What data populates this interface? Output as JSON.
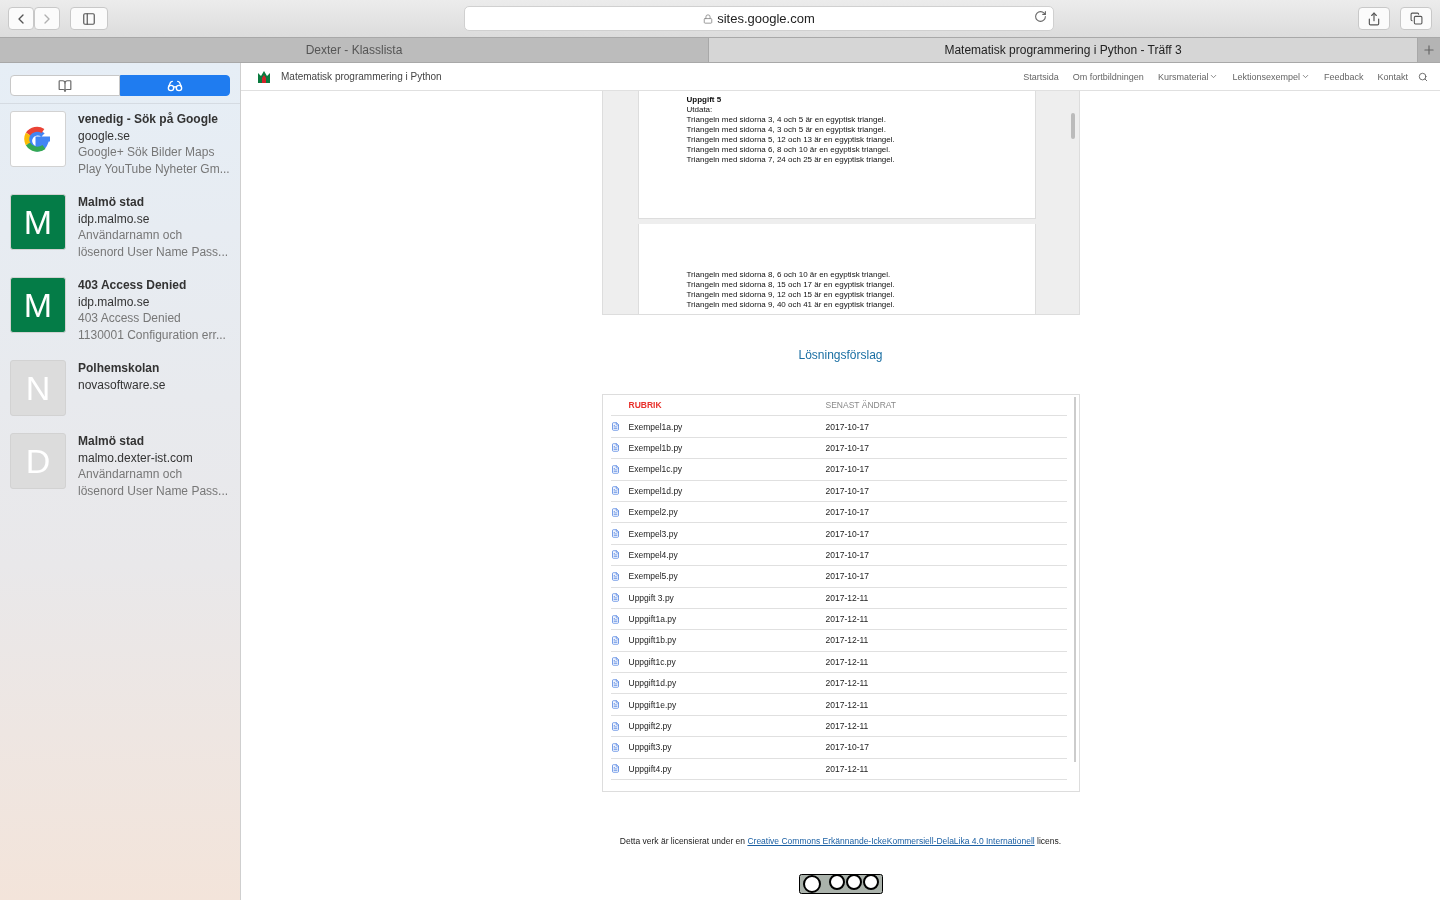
{
  "browser": {
    "address": "sites.google.com",
    "tabs": [
      {
        "title": "Dexter - Klasslista",
        "selected": false
      },
      {
        "title": "Matematisk programmering i Python - Träff 3",
        "selected": true
      }
    ]
  },
  "sidebar": {
    "segments": [
      {
        "kind": "bookmarks",
        "selected": false
      },
      {
        "kind": "reading-list",
        "selected": true
      }
    ],
    "items": [
      {
        "kind": "google",
        "title": "venedig - Sök på Google",
        "domain": "google.se",
        "description": [
          "Google+ Sök Bilder Maps",
          "Play YouTube Nyheter Gm..."
        ]
      },
      {
        "kind": "letter",
        "letter": "M",
        "color": "#047c47",
        "title": "Malmö stad",
        "domain": "idp.malmo.se",
        "description": [
          "Användarnamn och",
          "lösenord User Name Pass..."
        ]
      },
      {
        "kind": "letter",
        "letter": "M",
        "color": "#047c47",
        "title": "403 Access Denied",
        "domain": "idp.malmo.se",
        "description": [
          "403 Access Denied",
          "1130001 Configuration err..."
        ]
      },
      {
        "kind": "letter",
        "letter": "N",
        "color": "#dcdcdc",
        "title": "Polhemskolan",
        "domain": "novasoftware.se"
      },
      {
        "kind": "letter",
        "letter": "D",
        "color": "#dcdcdc",
        "title": "Malmö stad",
        "domain": "malmo.dexter-ist.com",
        "description": [
          "Användarnamn och",
          "lösenord User Name Pass..."
        ]
      }
    ]
  },
  "site": {
    "title": "Matematisk programmering i Python",
    "nav": [
      {
        "label": "Startsida",
        "dropdown": false
      },
      {
        "label": "Om fortbildningen",
        "dropdown": false
      },
      {
        "label": "Kursmaterial",
        "dropdown": true
      },
      {
        "label": "Lektionsexempel",
        "dropdown": true
      },
      {
        "label": "Feedback",
        "dropdown": false
      },
      {
        "label": "Kontakt",
        "dropdown": false
      }
    ]
  },
  "document": {
    "pages": [
      {
        "heading": "Uppgift 5",
        "lines": [
          "Utdata:",
          "Triangeln med sidorna 3, 4 och 5 är en egyptisk triangel.",
          "Triangeln med sidorna 4, 3 och 5 är en egyptisk triangel.",
          "Triangeln med sidorna 5, 12 och 13 är en egyptisk triangel.",
          "Triangeln med sidorna 6, 8 och 10 är en egyptisk triangel.",
          "Triangeln med sidorna 7, 24 och 25 är en egyptisk triangel."
        ]
      },
      {
        "lines": [
          "Triangeln med sidorna 8, 6 och 10 är en egyptisk triangel.",
          "Triangeln med sidorna 8, 15 och 17 är en egyptisk triangel.",
          "Triangeln med sidorna 9, 12 och 15 är en egyptisk triangel.",
          "Triangeln med sidorna 9, 40 och 41 är en egyptisk triangel."
        ]
      }
    ]
  },
  "solutions": {
    "heading": "Lösningsförslag",
    "columns": [
      "RUBRIK",
      "SENAST ÄNDRAT"
    ],
    "rows": [
      [
        "Exempel1a.py",
        "2017-10-17"
      ],
      [
        "Exempel1b.py",
        "2017-10-17"
      ],
      [
        "Exempel1c.py",
        "2017-10-17"
      ],
      [
        "Exempel1d.py",
        "2017-10-17"
      ],
      [
        "Exempel2.py",
        "2017-10-17"
      ],
      [
        "Exempel3.py",
        "2017-10-17"
      ],
      [
        "Exempel4.py",
        "2017-10-17"
      ],
      [
        "Exempel5.py",
        "2017-10-17"
      ],
      [
        "Uppgift 3.py",
        "2017-12-11"
      ],
      [
        "Uppgift1a.py",
        "2017-12-11"
      ],
      [
        "Uppgift1b.py",
        "2017-12-11"
      ],
      [
        "Uppgift1c.py",
        "2017-12-11"
      ],
      [
        "Uppgift1d.py",
        "2017-12-11"
      ],
      [
        "Uppgift1e.py",
        "2017-12-11"
      ],
      [
        "Uppgift2.py",
        "2017-12-11"
      ],
      [
        "Uppgift3.py",
        "2017-10-17"
      ],
      [
        "Uppgift4.py",
        "2017-12-11"
      ]
    ]
  },
  "footer": {
    "before": "Detta verk är licensierat under en",
    "link": "Creative Commons Erkännande-IckeKommersiell-DelaLika 4.0 Internationell",
    "after": "licens."
  }
}
